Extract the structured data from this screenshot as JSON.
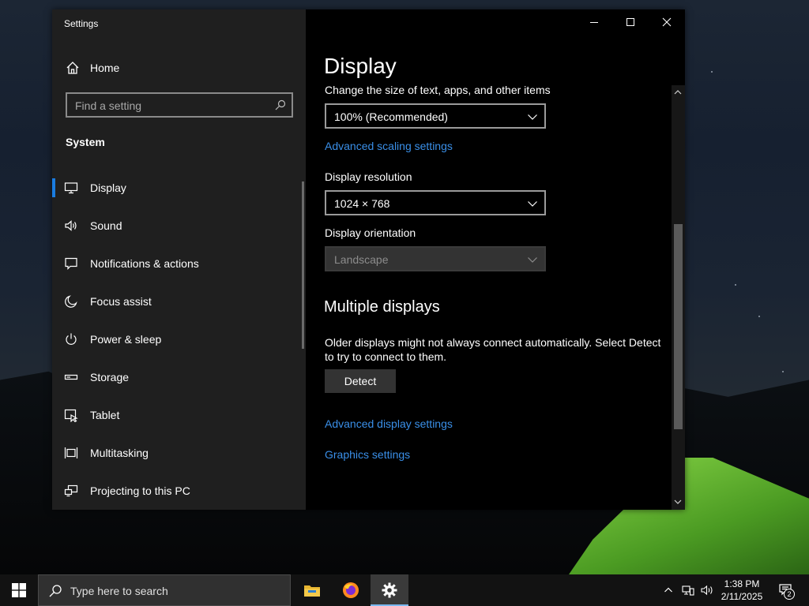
{
  "window": {
    "app_title": "Settings",
    "caption": {
      "minimize": "minimize",
      "maximize": "maximize",
      "close": "close"
    }
  },
  "sidebar": {
    "home_label": "Home",
    "search_placeholder": "Find a setting",
    "section_title": "System",
    "items": [
      {
        "label": "Display",
        "icon": "monitor-icon",
        "active": true
      },
      {
        "label": "Sound",
        "icon": "speaker-icon"
      },
      {
        "label": "Notifications & actions",
        "icon": "message-icon"
      },
      {
        "label": "Focus assist",
        "icon": "moon-icon"
      },
      {
        "label": "Power & sleep",
        "icon": "power-icon"
      },
      {
        "label": "Storage",
        "icon": "storage-icon"
      },
      {
        "label": "Tablet",
        "icon": "tablet-icon"
      },
      {
        "label": "Multitasking",
        "icon": "multitasking-icon"
      },
      {
        "label": "Projecting to this PC",
        "icon": "projector-icon"
      }
    ]
  },
  "main": {
    "title": "Display",
    "scale_label": "Change the size of text, apps, and other items",
    "scale_value": "100% (Recommended)",
    "advanced_scaling_link": "Advanced scaling settings",
    "resolution_label": "Display resolution",
    "resolution_value": "1024 × 768",
    "orientation_label": "Display orientation",
    "orientation_value": "Landscape",
    "multiple_displays_title": "Multiple displays",
    "multiple_displays_text": "Older displays might not always connect automatically. Select Detect to try to connect to them.",
    "detect_button": "Detect",
    "advanced_display_link": "Advanced display settings",
    "graphics_link": "Graphics settings"
  },
  "taskbar": {
    "search_placeholder": "Type here to search",
    "time": "1:38 PM",
    "date": "2/11/2025",
    "notification_count": "2"
  },
  "colors": {
    "accent": "#1a7ce0",
    "link": "#3a8fe8",
    "sidebar_bg": "#1f1f1f",
    "content_bg": "#000000",
    "taskbar_bg": "#121212"
  }
}
